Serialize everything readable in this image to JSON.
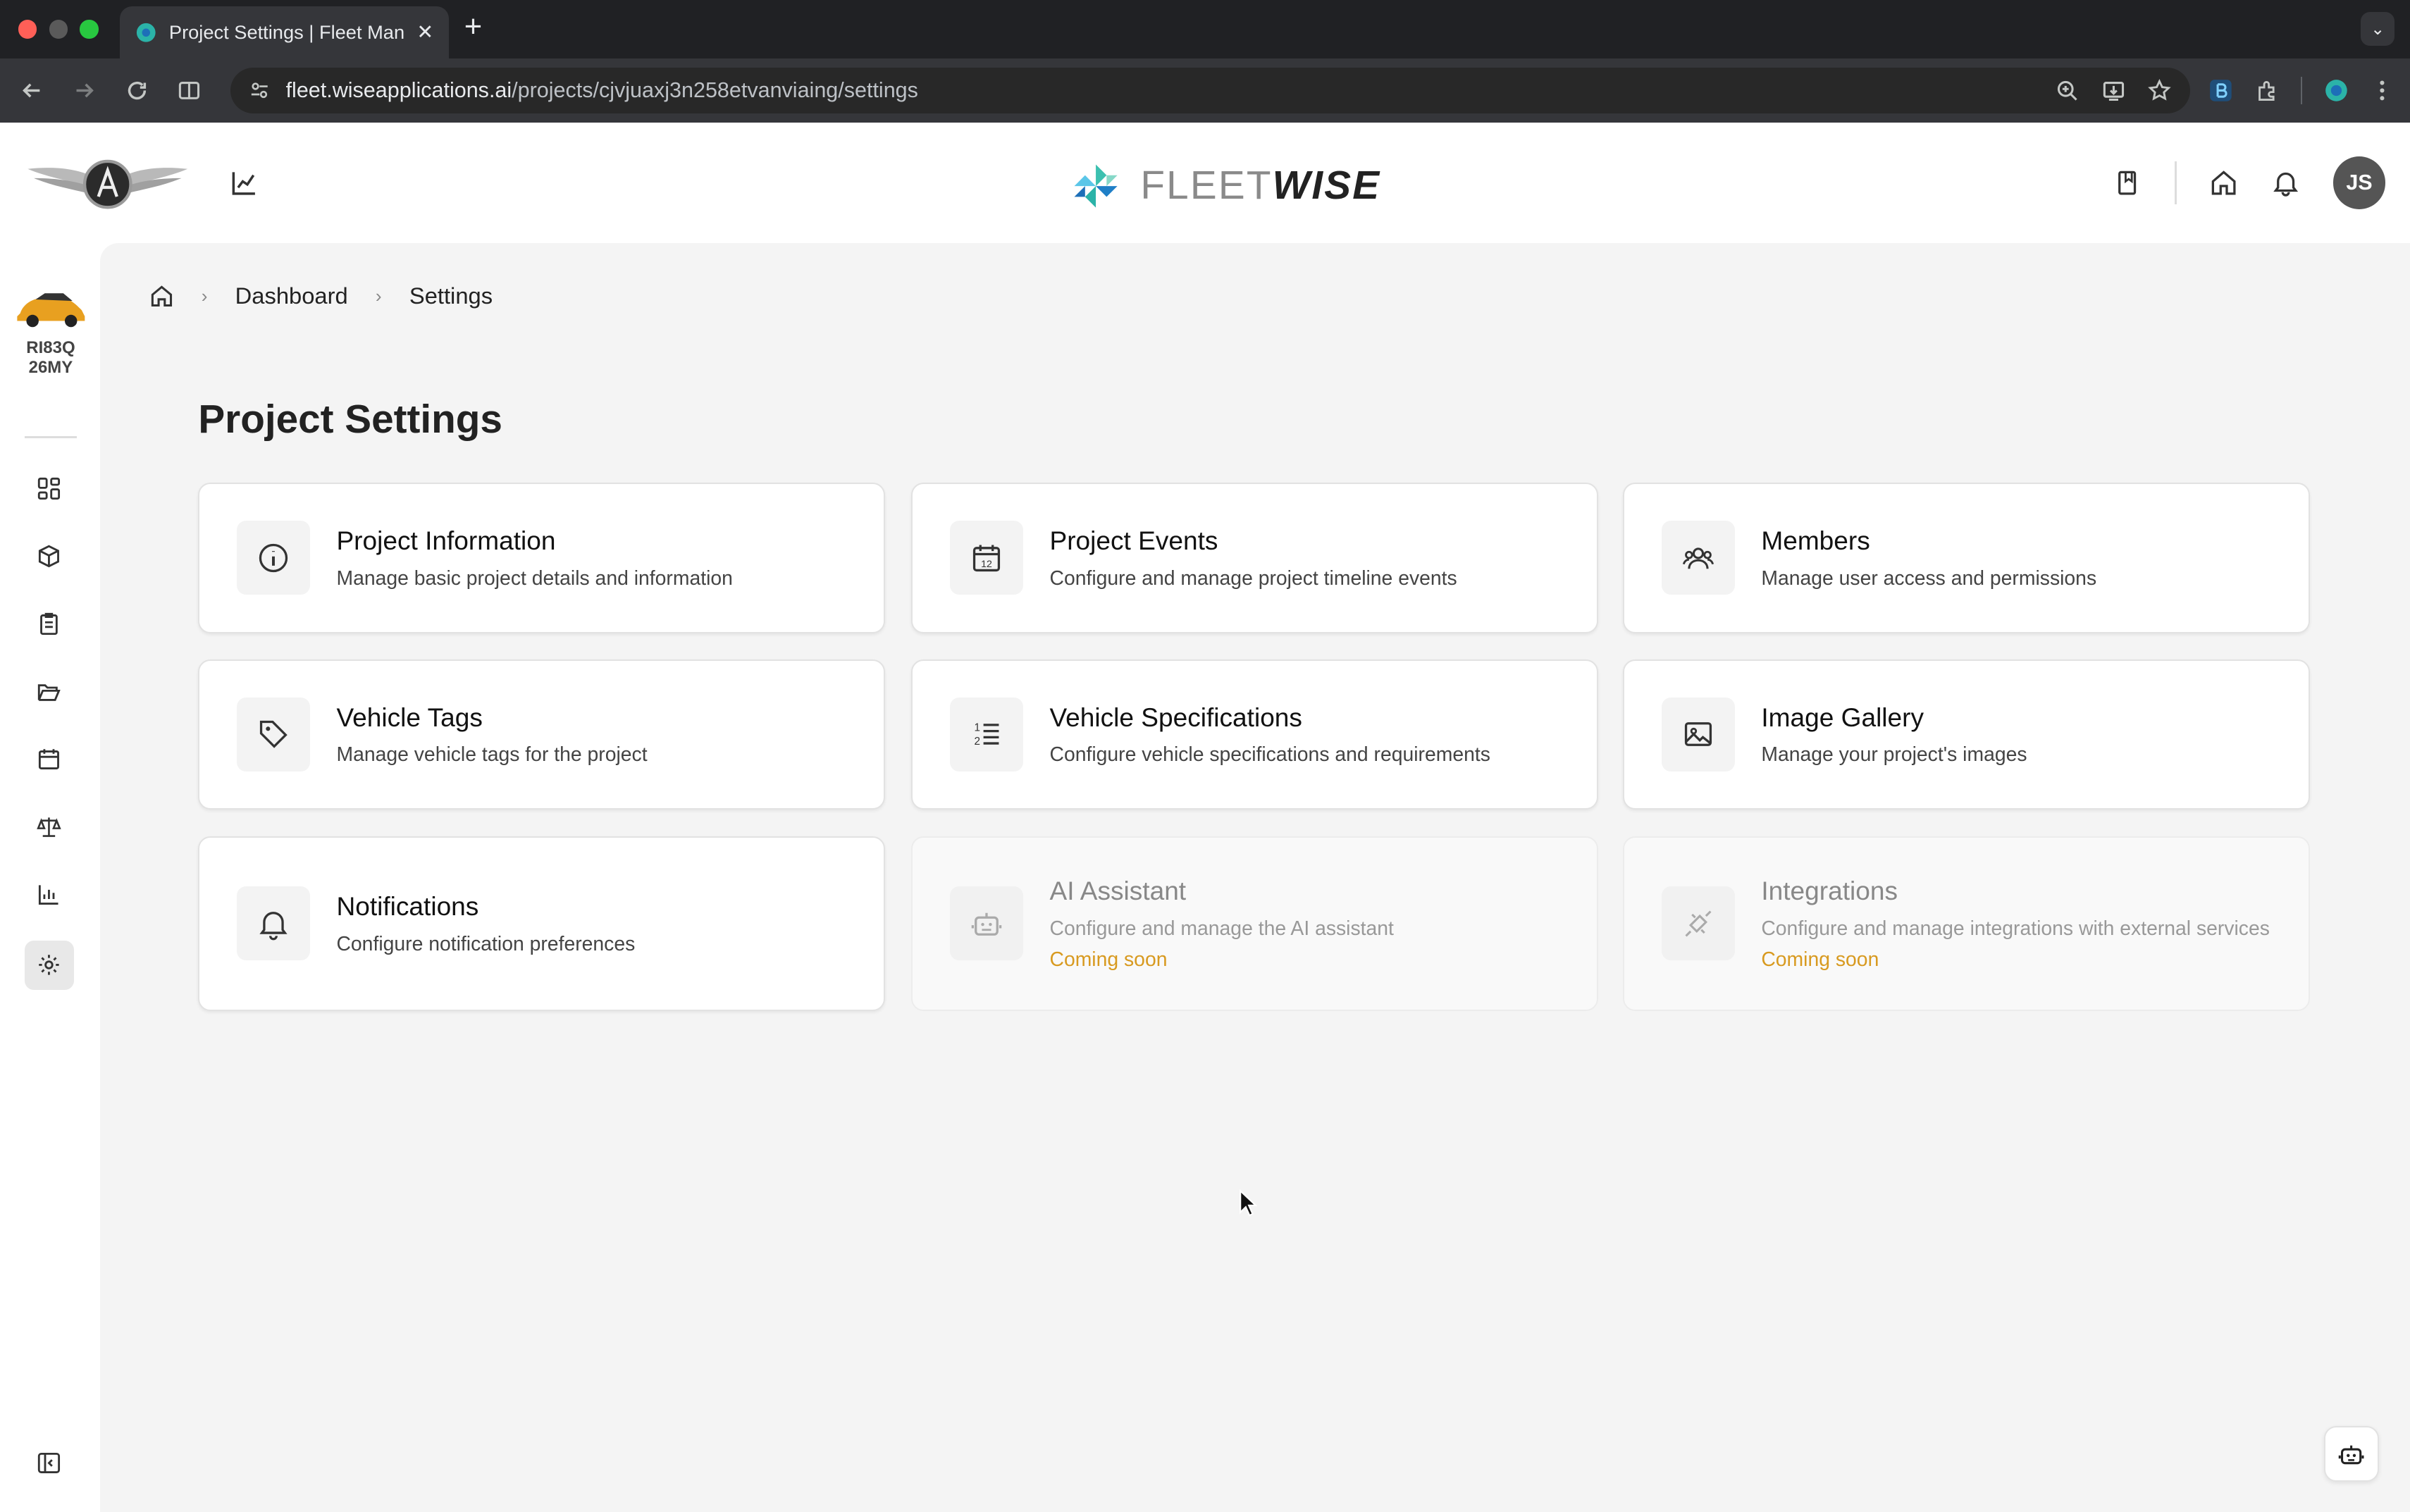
{
  "browser": {
    "tab_title": "Project Settings | Fleet Manag",
    "url_host": "fleet.wiseapplications.ai",
    "url_path": "/projects/cjvjuaxj3n258etvanviaing/settings"
  },
  "header": {
    "logo_word_light": "FLEET",
    "logo_word_bold": "WISE",
    "avatar_initials": "JS"
  },
  "sidebar": {
    "vehicle_line1": "RI83Q",
    "vehicle_line2": "26MY"
  },
  "breadcrumb": {
    "items": [
      "Dashboard",
      "Settings"
    ]
  },
  "page": {
    "title": "Project Settings"
  },
  "cards": [
    {
      "title": "Project Information",
      "desc": "Manage basic project details and information",
      "icon": "info-icon"
    },
    {
      "title": "Project Events",
      "desc": "Configure and manage project timeline events",
      "icon": "calendar-icon"
    },
    {
      "title": "Members",
      "desc": "Manage user access and permissions",
      "icon": "users-icon"
    },
    {
      "title": "Vehicle Tags",
      "desc": "Manage vehicle tags for the project",
      "icon": "tag-icon"
    },
    {
      "title": "Vehicle Specifications",
      "desc": "Configure vehicle specifications and requirements",
      "icon": "list-ordered-icon"
    },
    {
      "title": "Image Gallery",
      "desc": "Manage your project's images",
      "icon": "image-icon"
    },
    {
      "title": "Notifications",
      "desc": "Configure notification preferences",
      "icon": "bell-icon"
    },
    {
      "title": "AI Assistant",
      "desc": "Configure and manage the AI assistant",
      "status": "Coming soon",
      "icon": "bot-icon"
    },
    {
      "title": "Integrations",
      "desc": "Configure and manage integrations with external services",
      "status": "Coming soon",
      "icon": "plug-icon"
    }
  ],
  "colors": {
    "accent_soon": "#d89a20",
    "main_bg": "#f4f4f4"
  }
}
